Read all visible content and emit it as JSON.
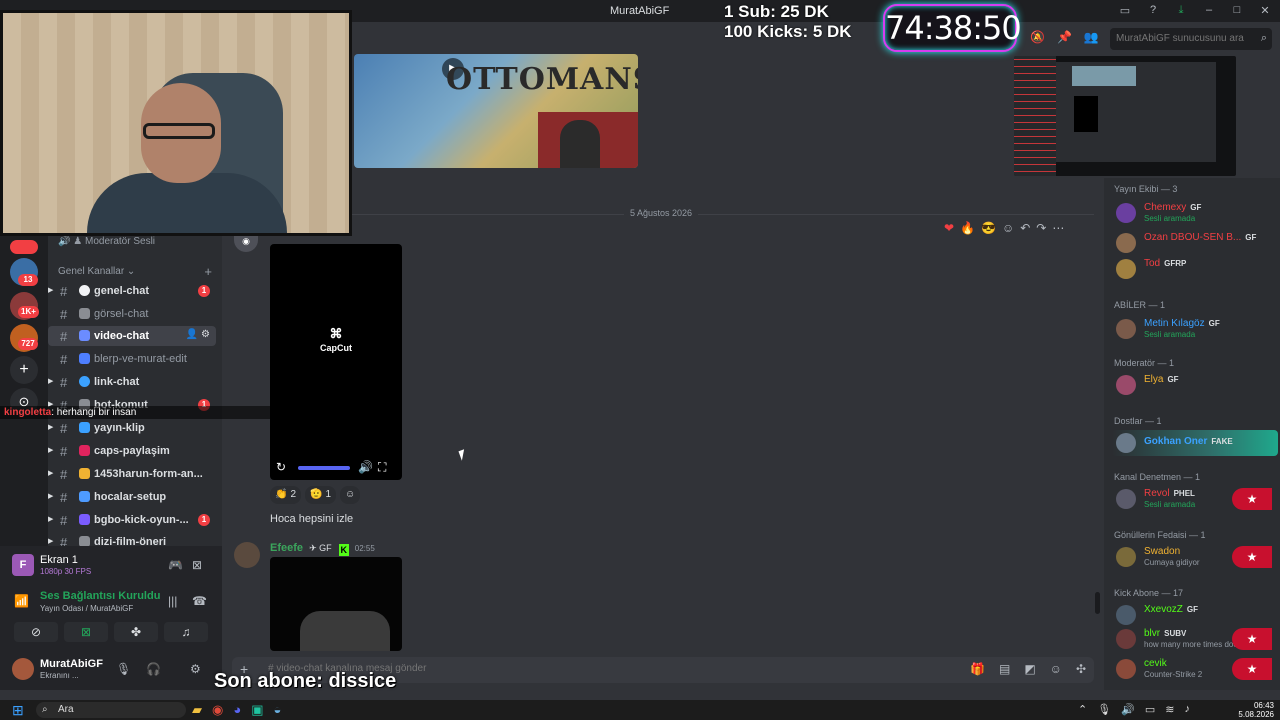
{
  "window": {
    "title": "MuratAbiGF"
  },
  "stream_overlay": {
    "line1": "1 Sub: 25 DK",
    "line2": "100 Kicks: 5 DK",
    "timer": "74:38:50",
    "last_sub": "Son abone: dissice",
    "chat_user": "kingoletta",
    "chat_message": ": herhangi bir insan"
  },
  "header": {
    "search_placeholder": "MuratAbiGF sunucusunu ara"
  },
  "server_badges": [
    "13",
    "1K+",
    "727"
  ],
  "channels": {
    "top_item": "Moderatör Sesli",
    "category": "Genel Kanallar",
    "items": [
      {
        "name": "genel-chat",
        "badge": "1",
        "color": "#f2f3f5"
      },
      {
        "name": "görsel-chat",
        "badge": "",
        "color": "#8a8d93"
      },
      {
        "name": "video-chat",
        "badge": "",
        "color": "#6b8cff"
      },
      {
        "name": "blerp-ve-murat-edit",
        "badge": "",
        "color": "#4e7fff"
      },
      {
        "name": "link-chat",
        "badge": "",
        "color": "#3ba1ff"
      },
      {
        "name": "bot-komut",
        "badge": "1",
        "color": "#8a8d93"
      },
      {
        "name": "yayın-klip",
        "badge": "",
        "color": "#3ba1ff"
      },
      {
        "name": "caps-paylaşim",
        "badge": "",
        "color": "#e0245e"
      },
      {
        "name": "1453harun-form-an...",
        "badge": "",
        "color": "#f0b232"
      },
      {
        "name": "hocalar-setup",
        "badge": "",
        "color": "#4e9bff"
      },
      {
        "name": "bgbo-kick-oyun-...",
        "badge": "1",
        "color": "#7a5cff"
      },
      {
        "name": "dizi-film-öneri",
        "badge": "",
        "color": "#8a8d93"
      }
    ]
  },
  "voice_panel": {
    "screen_title": "Ekran 1",
    "screen_sub": "1080p 30 FPS",
    "conn_title": "Ses Bağlantısı Kuruldu",
    "conn_sub": "Yayın Odası / MuratAbiGF",
    "user_name": "MuratAbiGF",
    "user_status": "Ekranını ..."
  },
  "chat": {
    "date_divider": "5 Ağustos 2026",
    "video_label": "CapCut",
    "reactions": [
      {
        "emoji": "👏",
        "count": "2"
      },
      {
        "emoji": "🫡",
        "count": "1"
      }
    ],
    "message_text": "Hoca hepsini izle",
    "msg2_author": "Efeefe",
    "msg2_tag": "GF",
    "msg2_time": "02:55",
    "composer_placeholder": "# video-chat kanalına mesaj gönder"
  },
  "members": {
    "groups": [
      {
        "label": "Yayın Ekibi — 3"
      },
      {
        "label": "ABİLER — 1"
      },
      {
        "label": "Moderatör — 1"
      },
      {
        "label": "Dostlar — 1"
      },
      {
        "label": "Kanal Denetmen — 1"
      },
      {
        "label": "Gönüllerin Fedaisi — 1"
      },
      {
        "label": "Kick Abone — 17"
      }
    ],
    "people": [
      {
        "name": "Chemexy",
        "tag": "GF",
        "sub": "Sesli aramada",
        "color": "#f23f43"
      },
      {
        "name": "Ozan DBOU-SEN B...",
        "tag": "GF",
        "sub": "",
        "color": "#f23f43"
      },
      {
        "name": "Tod",
        "tag": "GFRP",
        "sub": "",
        "color": "#f23f43"
      },
      {
        "name": "Metin Kılagöz",
        "tag": "GF",
        "sub": "Sesli aramada",
        "color": "#3ba1ff"
      },
      {
        "name": "Elya",
        "tag": "GF",
        "sub": "",
        "color": "#f0b232"
      },
      {
        "name": "Gokhan Oner",
        "tag": "FAKE",
        "sub": "",
        "color": "#3ba1ff"
      },
      {
        "name": "Revol",
        "tag": "PHEL",
        "sub": "Sesli aramada",
        "color": "#f23f43"
      },
      {
        "name": "Swadon",
        "tag": "",
        "sub": "Cumaya gidiyor",
        "color": "#f0b232"
      },
      {
        "name": "XxevozZ",
        "tag": "GF",
        "sub": "",
        "color": "#53fc18"
      },
      {
        "name": "blvr",
        "tag": "SUBV",
        "sub": "how many more times doe...",
        "color": "#53fc18"
      },
      {
        "name": "cevik",
        "tag": "",
        "sub": "Counter-Strike 2",
        "color": "#53fc18"
      }
    ]
  },
  "taskbar": {
    "search": "Ara",
    "time": "06:43",
    "date": "5.08.2026"
  }
}
